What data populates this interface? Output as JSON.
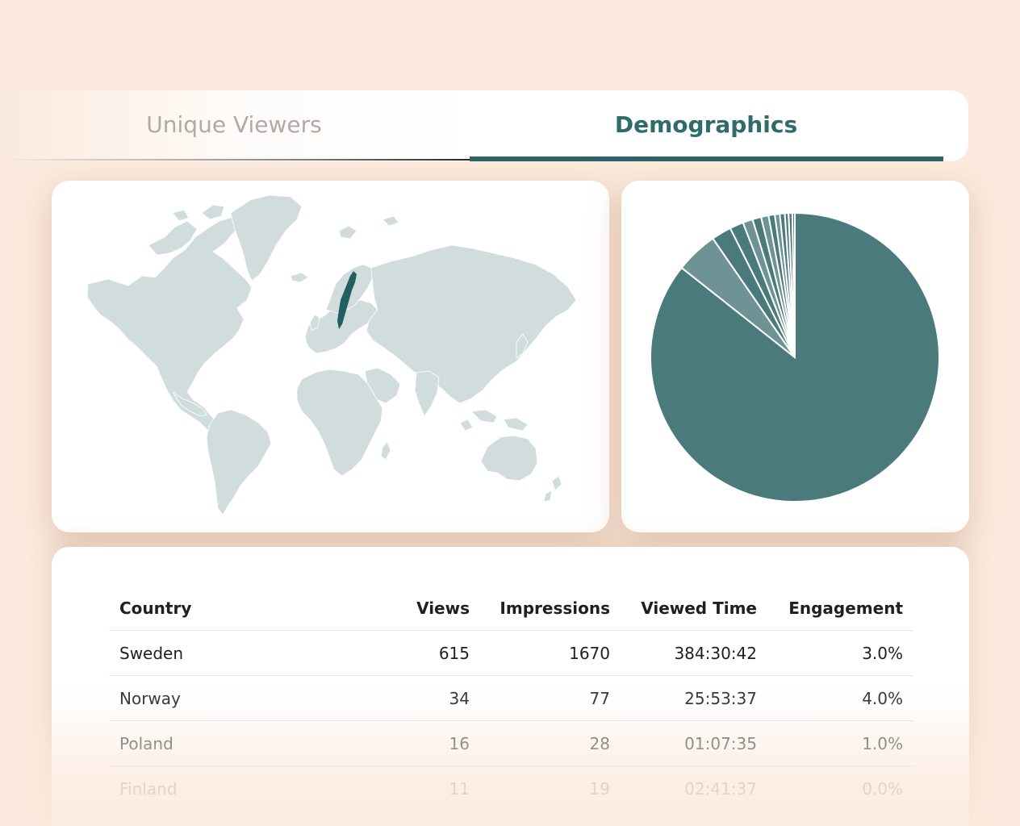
{
  "tabs": [
    {
      "label": "Unique Viewers",
      "active": false
    },
    {
      "label": "Demographics",
      "active": true
    }
  ],
  "colors": {
    "accent": "#2f6467",
    "map_land": "#d1dcdc",
    "map_highlight": "#235e60",
    "pie_main": "#4b7a7d",
    "pie_light": "#6e9394"
  },
  "map": {
    "highlighted_country": "Sweden"
  },
  "chart_data": {
    "type": "pie",
    "categories": [
      "Sweden",
      "Norway",
      "Poland",
      "Finland",
      "",
      "",
      "",
      "",
      "",
      "",
      "",
      "",
      ""
    ],
    "values": [
      615,
      34,
      16,
      11,
      8,
      7,
      6,
      5,
      4,
      4,
      3,
      3,
      2
    ]
  },
  "table": {
    "headers": [
      "Country",
      "Views",
      "Impressions",
      "Viewed Time",
      "Engagement"
    ],
    "rows": [
      [
        "Sweden",
        "615",
        "1670",
        "384:30:42",
        "3.0%"
      ],
      [
        "Norway",
        "34",
        "77",
        "25:53:37",
        "4.0%"
      ],
      [
        "Poland",
        "16",
        "28",
        "01:07:35",
        "1.0%"
      ],
      [
        "Finland",
        "11",
        "19",
        "02:41:37",
        "0.0%"
      ]
    ]
  }
}
